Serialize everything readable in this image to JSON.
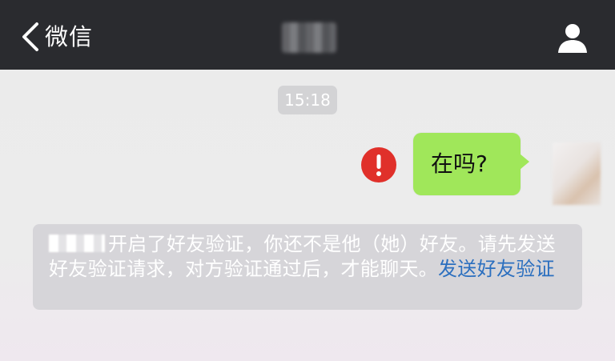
{
  "header": {
    "back_label": "微信",
    "title": "",
    "back_icon": "chevron-left-icon",
    "profile_icon": "person-icon"
  },
  "chat": {
    "timestamp": "15:18",
    "messages": [
      {
        "sender": "self",
        "text": "在吗?",
        "status": "send-failed"
      }
    ],
    "system_notice": {
      "text": "开启了好友验证，你还不是他（她）好友。请先发送好友验证请求，对方验证通过后，才能聊天。",
      "link_text": "发送好友验证"
    }
  },
  "colors": {
    "navbar_bg": "#2a2b2f",
    "chat_bg": "#ebebeb",
    "bubble_bg": "#a0e75a",
    "error_red": "#e0302a",
    "notice_bg": "#d6d5d9",
    "link_blue": "#2b6fbf"
  }
}
